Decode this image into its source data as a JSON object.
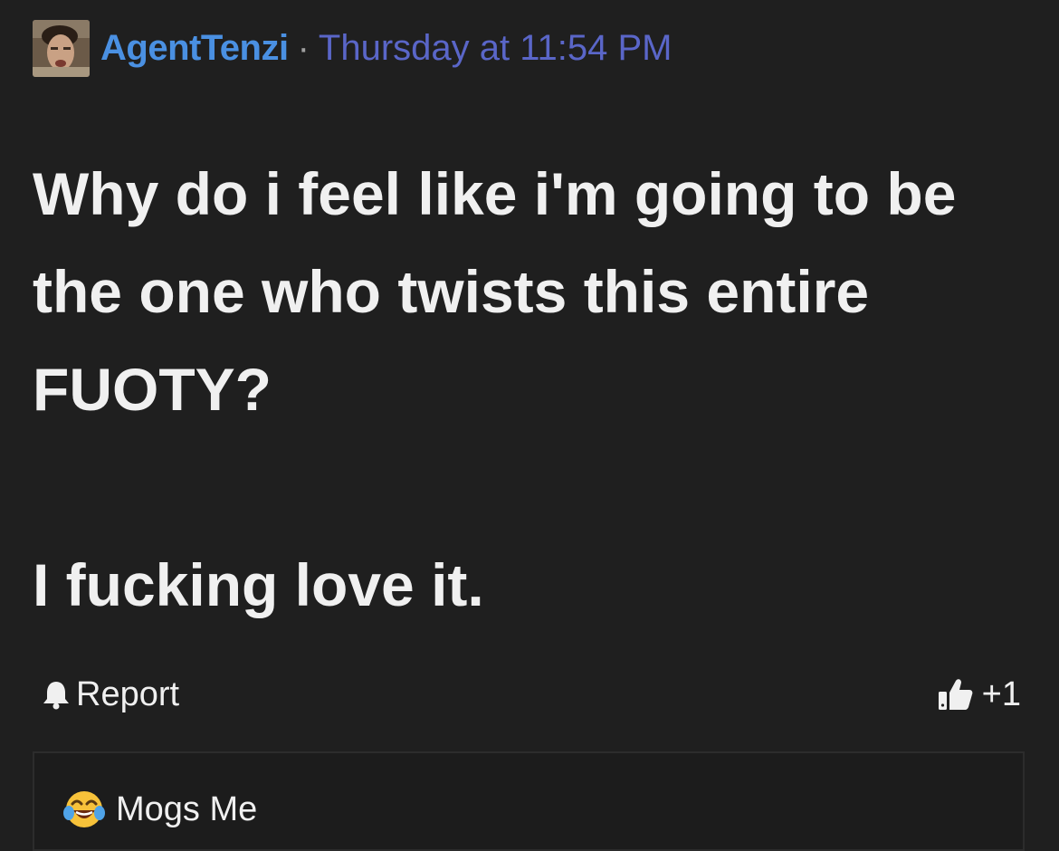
{
  "post": {
    "author": "AgentTenzi",
    "separator": "·",
    "timestamp": "Thursday at 11:54 PM",
    "body_paragraphs": [
      "Why do i feel like i'm going to be the one who twists this entire FUOTY?",
      "I fucking love it."
    ]
  },
  "actions": {
    "report_label": "Report",
    "like_count": "+1"
  },
  "reactions": {
    "summary_label": "Mogs Me"
  },
  "icons": {
    "report": "bell-icon",
    "like": "thumbs-up-icon",
    "reaction": "laughing-crying-emoji-icon"
  },
  "colors": {
    "background": "#1f1f1f",
    "username": "#4a90e2",
    "timestamp": "#5a66c8",
    "text": "#f0f0f0"
  }
}
